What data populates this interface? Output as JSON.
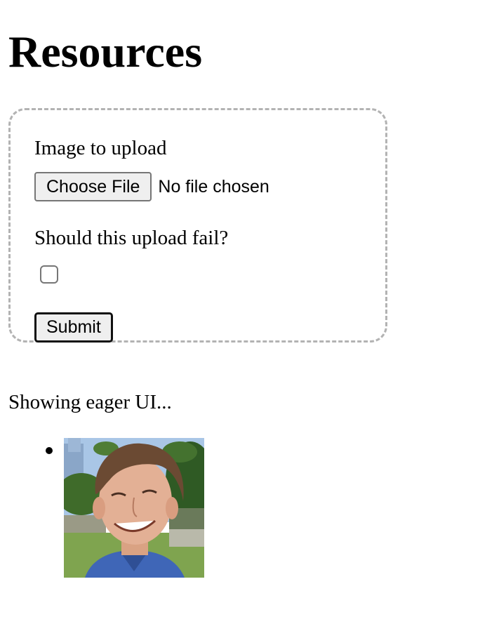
{
  "page": {
    "title": "Resources"
  },
  "form": {
    "image_label": "Image to upload",
    "file_button_label": "Choose File",
    "file_status": "No file chosen",
    "fail_label": "Should this upload fail?",
    "fail_checked": false,
    "submit_label": "Submit"
  },
  "status": {
    "message": "Showing eager UI..."
  },
  "uploads": [
    {
      "kind": "photo",
      "description_icon": "person-photo"
    }
  ]
}
